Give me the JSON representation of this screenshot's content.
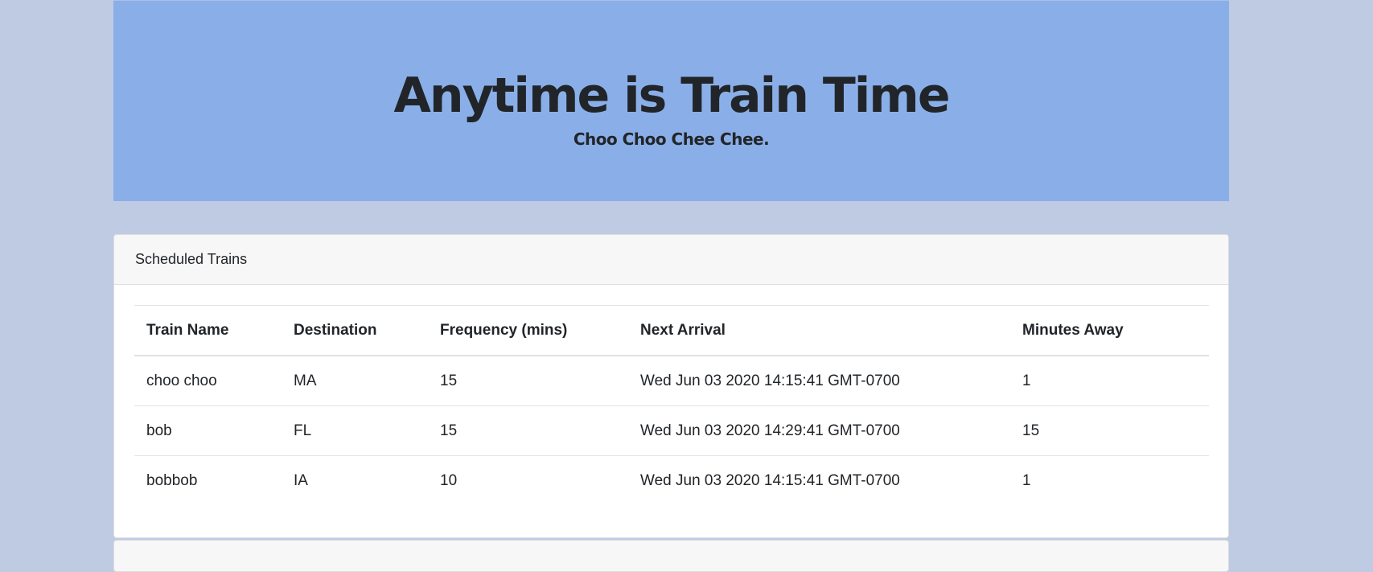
{
  "header": {
    "title": "Anytime is Train Time",
    "subtitle": "Choo Choo Chee Chee."
  },
  "schedule": {
    "title": "Scheduled Trains",
    "columns": [
      "Train Name",
      "Destination",
      "Frequency (mins)",
      "Next Arrival",
      "Minutes Away"
    ],
    "rows": [
      {
        "name": "choo choo",
        "destination": "MA",
        "frequency": "15",
        "next_arrival": "Wed Jun 03 2020 14:15:41 GMT-0700",
        "minutes_away": "1"
      },
      {
        "name": "bob",
        "destination": "FL",
        "frequency": "15",
        "next_arrival": "Wed Jun 03 2020 14:29:41 GMT-0700",
        "minutes_away": "15"
      },
      {
        "name": "bobbob",
        "destination": "IA",
        "frequency": "10",
        "next_arrival": "Wed Jun 03 2020 14:15:41 GMT-0700",
        "minutes_away": "1"
      }
    ]
  }
}
